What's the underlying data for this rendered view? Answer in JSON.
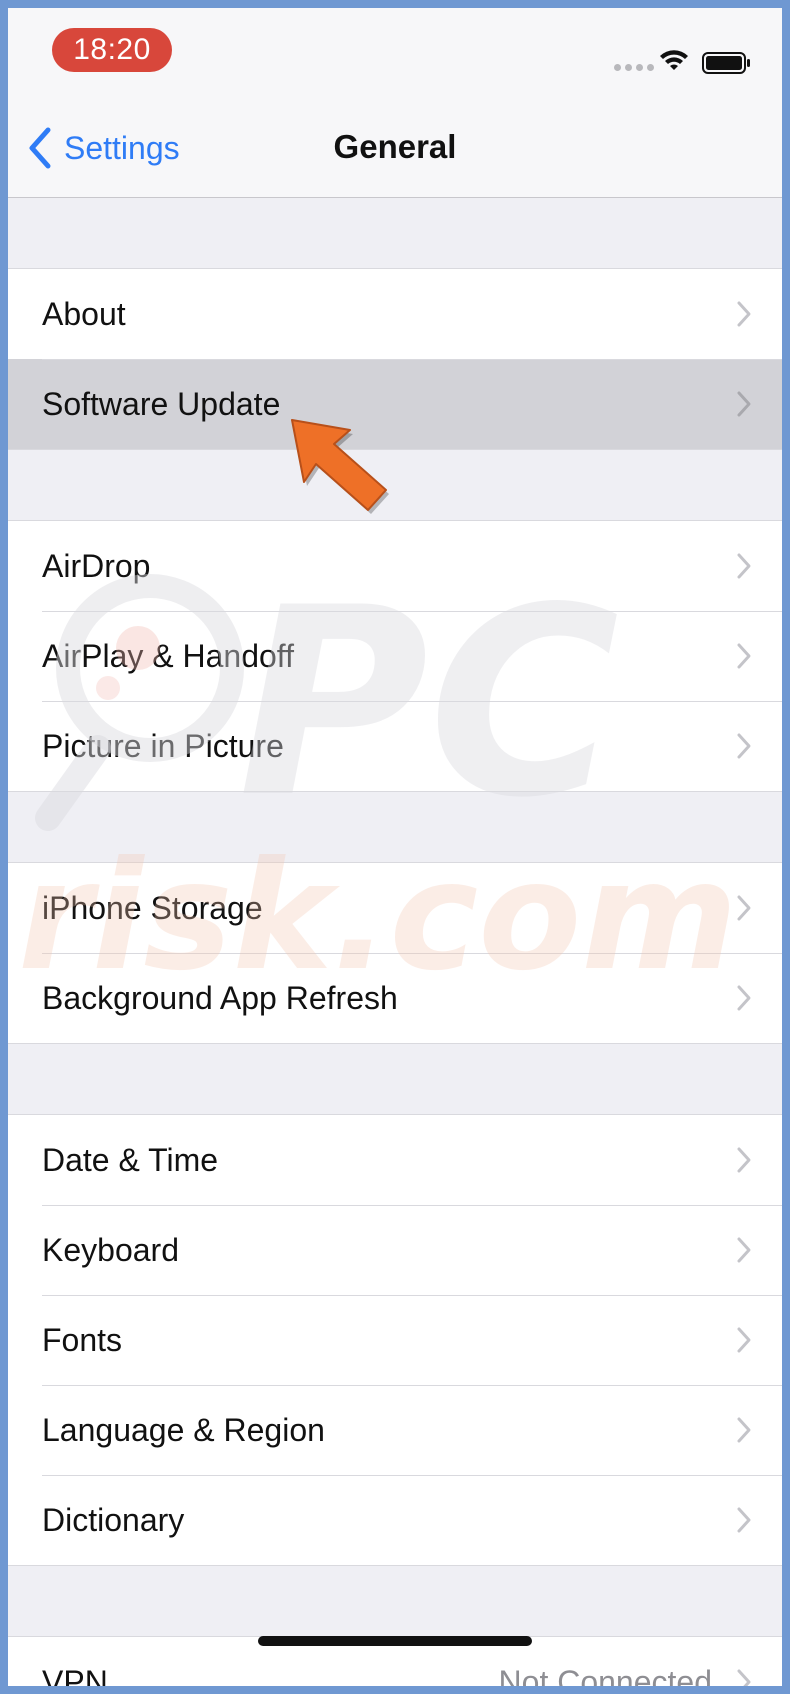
{
  "status": {
    "time": "18:20"
  },
  "nav": {
    "back_label": "Settings",
    "title": "General"
  },
  "groups": [
    {
      "rows": [
        {
          "label": "About"
        },
        {
          "label": "Software Update"
        }
      ]
    },
    {
      "rows": [
        {
          "label": "AirDrop"
        },
        {
          "label": "AirPlay & Handoff"
        },
        {
          "label": "Picture in Picture"
        }
      ]
    },
    {
      "rows": [
        {
          "label": "iPhone Storage"
        },
        {
          "label": "Background App Refresh"
        }
      ]
    },
    {
      "rows": [
        {
          "label": "Date & Time"
        },
        {
          "label": "Keyboard"
        },
        {
          "label": "Fonts"
        },
        {
          "label": "Language & Region"
        },
        {
          "label": "Dictionary"
        }
      ]
    },
    {
      "rows": [
        {
          "label": "VPN",
          "value": "Not Connected"
        }
      ]
    }
  ],
  "watermark": {
    "line1": "PC",
    "line2": "risk.com"
  },
  "colors": {
    "accent": "#2f7cf6",
    "time_pill": "#d8473b",
    "arrow": "#ee7027",
    "highlight_row": "#d2d2d7"
  },
  "icons": {
    "back": "chevron-left-icon",
    "row_disclosure": "chevron-right-icon",
    "wifi": "wifi-icon",
    "battery": "battery-icon",
    "annotation": "pointer-arrow-icon"
  }
}
